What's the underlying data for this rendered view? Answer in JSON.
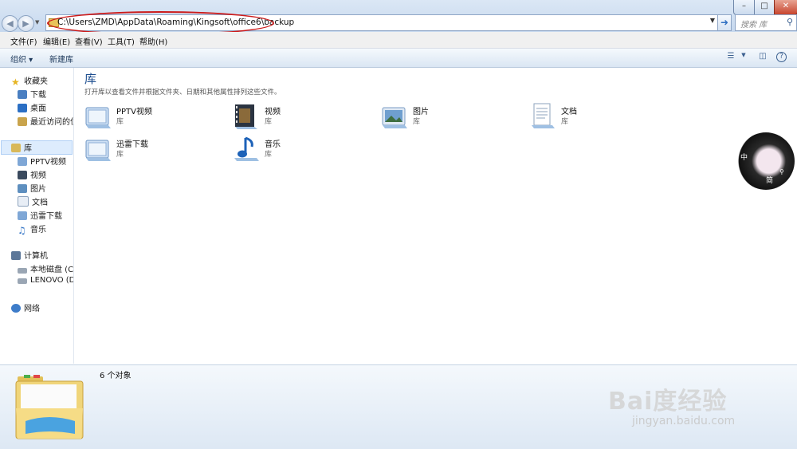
{
  "window": {
    "minimize_glyph": "–",
    "maximize_glyph": "□",
    "close_glyph": "✕"
  },
  "address_bar": {
    "path": "C:\\Users\\ZMD\\AppData\\Roaming\\Kingsoft\\office6\\backup",
    "highlight_color": "#cc1b1b"
  },
  "search": {
    "placeholder": "搜索 库",
    "icon": "search-icon"
  },
  "menu": [
    "文件(F)",
    "编辑(E)",
    "查看(V)",
    "工具(T)",
    "帮助(H)"
  ],
  "command_bar": {
    "organize": "组织 ▾",
    "new_library": "新建库"
  },
  "nav": {
    "favorites": {
      "label": "收藏夹",
      "items": [
        "下载",
        "桌面",
        "最近访问的位"
      ]
    },
    "libraries": {
      "label": "库",
      "items": [
        "PPTV视频",
        "视频",
        "图片",
        "文档",
        "迅雷下载",
        "音乐"
      ]
    },
    "computer": {
      "label": "计算机",
      "items": [
        "本地磁盘 (C:)",
        "LENOVO (D:)"
      ]
    },
    "network": {
      "label": "网络"
    }
  },
  "main": {
    "title": "库",
    "subtitle": "打开库以查看文件并根据文件夹、日期和其他属性排列这些文件。",
    "libraries": [
      {
        "name": "PPTV视频",
        "type": "库",
        "icon": "library-video-icon"
      },
      {
        "name": "视频",
        "type": "库",
        "icon": "film-library-icon"
      },
      {
        "name": "图片",
        "type": "库",
        "icon": "picture-library-icon"
      },
      {
        "name": "文档",
        "type": "库",
        "icon": "document-library-icon"
      },
      {
        "name": "迅雷下载",
        "type": "库",
        "icon": "library-video-icon"
      },
      {
        "name": "音乐",
        "type": "库",
        "icon": "music-library-icon"
      }
    ]
  },
  "details": {
    "count": "6 个对象"
  },
  "ime_badge": {
    "mode": "中",
    "sub": "简"
  },
  "watermark": {
    "brand": "Bai度经验",
    "url": "jingyan.baidu.com"
  }
}
